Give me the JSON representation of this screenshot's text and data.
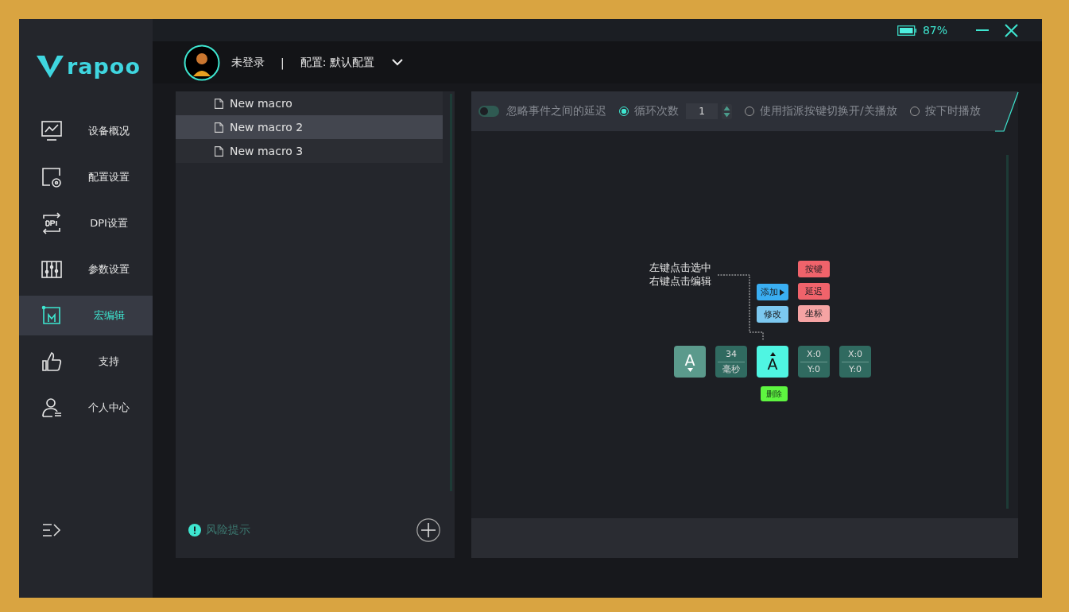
{
  "window": {
    "battery": "87%"
  },
  "sidebar": {
    "logo": "rapoo",
    "items": [
      {
        "label": "设备概况",
        "selected": false
      },
      {
        "label": "配置设置",
        "selected": false
      },
      {
        "label": "DPI设置",
        "selected": false
      },
      {
        "label": "参数设置",
        "selected": false
      },
      {
        "label": "宏编辑",
        "selected": true
      },
      {
        "label": "支持",
        "selected": false
      },
      {
        "label": "个人中心",
        "selected": false
      }
    ]
  },
  "header": {
    "user": "未登录",
    "separator": "|",
    "profile": "配置: 默认配置"
  },
  "macros": {
    "items": [
      {
        "name": "New macro",
        "selected": false
      },
      {
        "name": "New macro 2",
        "selected": true
      },
      {
        "name": "New macro 3",
        "selected": false
      }
    ],
    "risk_hint": "风险提示"
  },
  "options": {
    "ignore_delay": {
      "label": "忽略事件之间的延迟",
      "on": false
    },
    "loop_count": "1",
    "play_modes": [
      {
        "label": "循环次数",
        "selected": true
      },
      {
        "label": "使用指派按键切换开/关播放",
        "selected": false
      },
      {
        "label": "按下时播放",
        "selected": false
      }
    ]
  },
  "editor": {
    "hint": [
      "左键点击选中",
      "右键点击编辑"
    ],
    "events": [
      {
        "kind": "key",
        "label": "A",
        "released": false,
        "selected": false
      },
      {
        "kind": "delay",
        "value": "34",
        "unit": "毫秒",
        "selected": false
      },
      {
        "kind": "key",
        "label": "A",
        "released": true,
        "selected": true
      },
      {
        "kind": "move",
        "x": "X:0",
        "y": "Y:0",
        "selected": false
      },
      {
        "kind": "move",
        "x": "X:0",
        "y": "Y:0",
        "selected": false
      }
    ],
    "context_menu": [
      {
        "label": "添加",
        "submenu": true,
        "selected": true
      },
      {
        "label": "修改",
        "submenu": false,
        "selected": false
      }
    ],
    "submenu": [
      {
        "label": "按键",
        "color": "#f0636b"
      },
      {
        "label": "延迟",
        "color": "#f0636b"
      },
      {
        "label": "坐标",
        "color": "#f5a3a3"
      }
    ],
    "delete": "删除"
  }
}
